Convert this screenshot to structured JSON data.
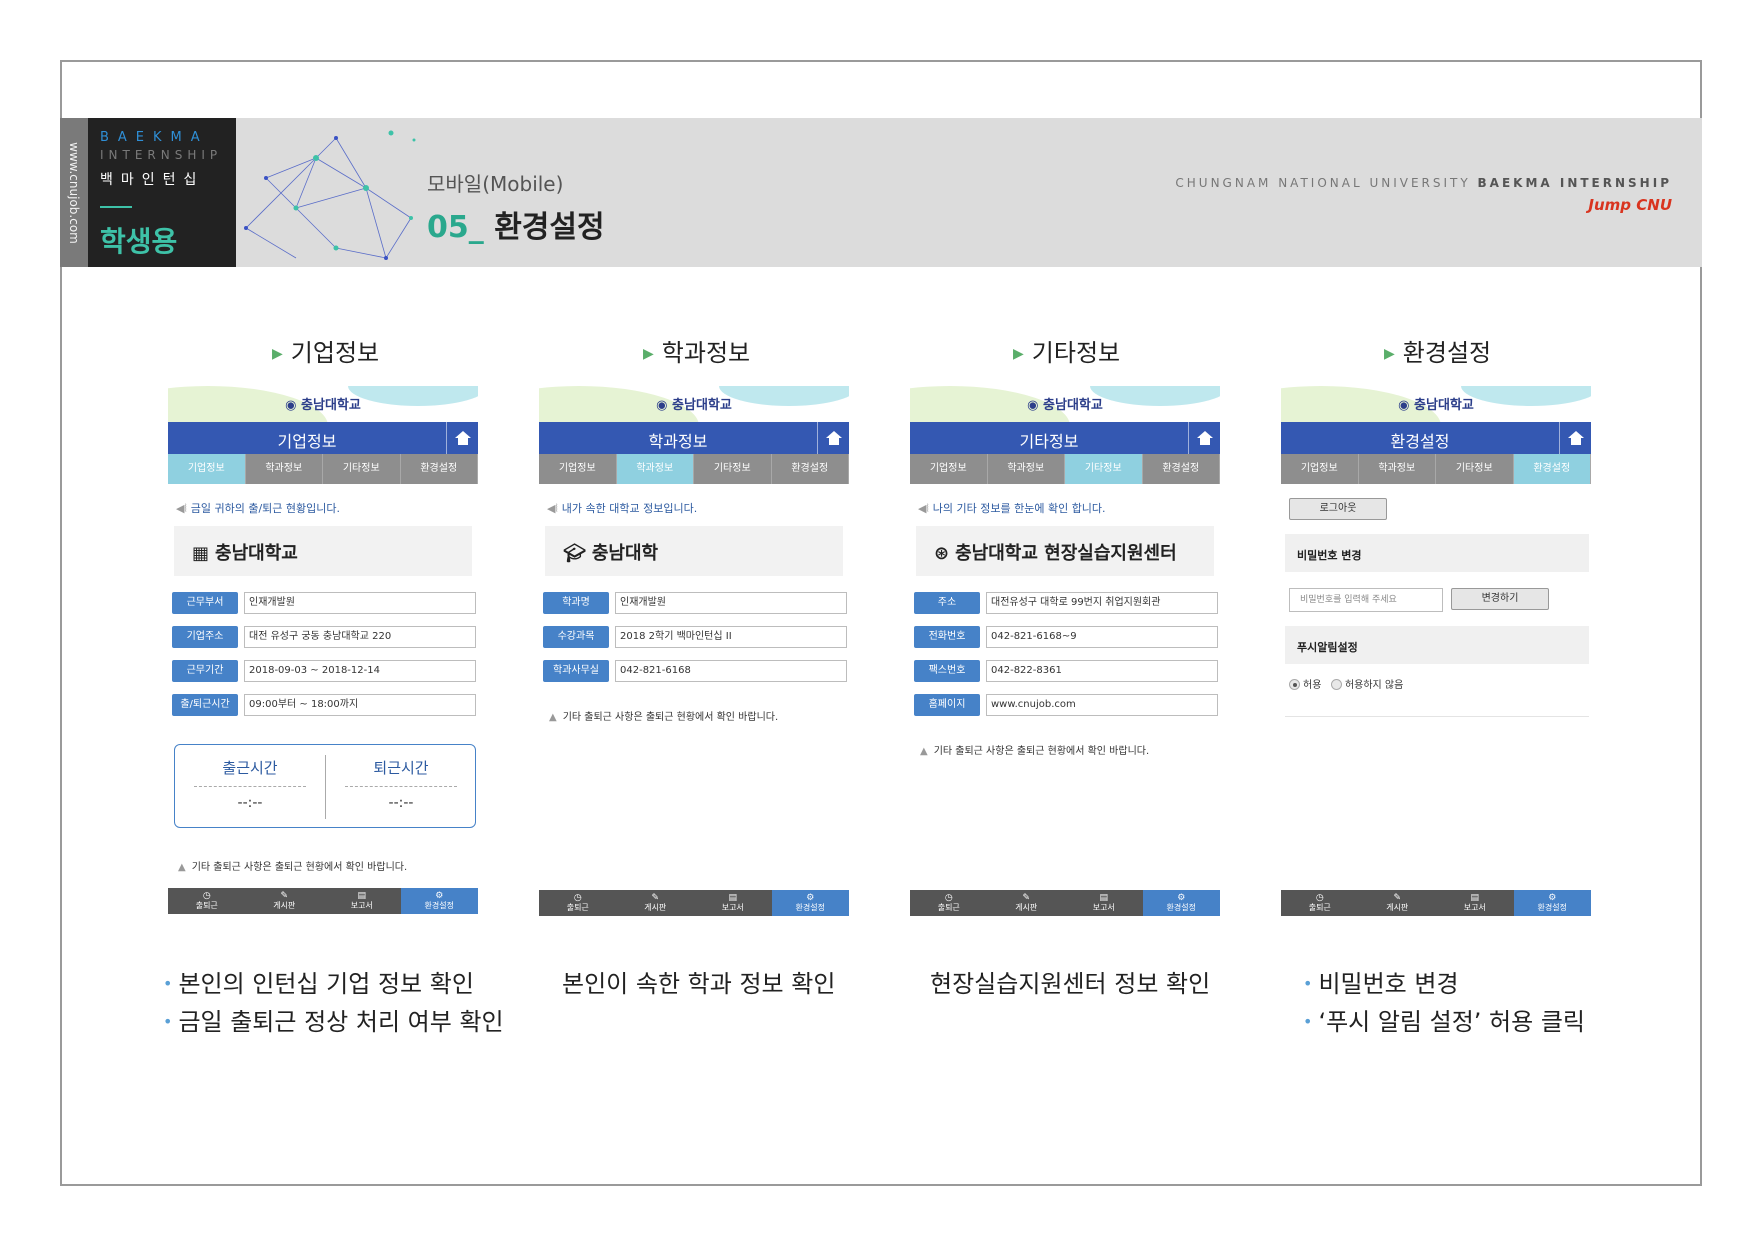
{
  "header": {
    "side_url": "www.cnujob.com",
    "logo_line1": "BAEKMA",
    "logo_line2": "INTERNSHIP",
    "logo_line3": "백마인턴십",
    "logo_line4": "학생용",
    "subtitle": "모바일(Mobile)",
    "title_num": "05_",
    "title_text": "환경설정",
    "right_text_light": "CHUNGNAM NATIONAL UNIVERSITY",
    "right_text_bold": "BAEKMA INTERNSHIP",
    "brand": "Jump CNU"
  },
  "common": {
    "univ_logo": "충남대학교",
    "tabs": [
      "기업정보",
      "학과정보",
      "기타정보",
      "환경설정"
    ],
    "nav": [
      "출퇴근",
      "게시판",
      "보고서",
      "환경설정"
    ],
    "footnote": "기타 출퇴근 사항은 출퇴근 현황에서 확인 바랍니다."
  },
  "screens": [
    {
      "heading": "기업정보",
      "title": "기업정보",
      "notice": "금일 귀하의 출/퇴근 현황입니다.",
      "card": "충남대학교",
      "fields": [
        {
          "label": "근무부서",
          "value": "인재개발원"
        },
        {
          "label": "기업주소",
          "value": "대전 유성구 궁동 충남대학교 220"
        },
        {
          "label": "근무기간",
          "value": "2018-09-03 ~ 2018-12-14"
        },
        {
          "label": "출/퇴근시간",
          "value": "09:00부터 ~ 18:00까지"
        }
      ],
      "checkin_label": "출근시간",
      "checkin_value": "--:--",
      "checkout_label": "퇴근시간",
      "checkout_value": "--:--"
    },
    {
      "heading": "학과정보",
      "title": "학과정보",
      "notice": "내가 속한 대학교 정보입니다.",
      "card": "충남대학",
      "fields": [
        {
          "label": "학과명",
          "value": "인재개발원"
        },
        {
          "label": "수강과목",
          "value": "2018 2학기 백마인턴십 II"
        },
        {
          "label": "학과사무실",
          "value": "042-821-6168"
        }
      ]
    },
    {
      "heading": "기타정보",
      "title": "기타정보",
      "notice": "나의 기타 정보를 한눈에 확인 합니다.",
      "card": "충남대학교 현장실습지원센터",
      "fields": [
        {
          "label": "주소",
          "value": "대전유성구 대학로 99번지 취업지원회관"
        },
        {
          "label": "전화번호",
          "value": "042-821-6168~9"
        },
        {
          "label": "팩스번호",
          "value": "042-822-8361"
        },
        {
          "label": "홈페이지",
          "value": "www.cnujob.com"
        }
      ]
    },
    {
      "heading": "환경설정",
      "title": "환경설정",
      "logout_label": "로그아웃",
      "pw_section": "비밀번호 변경",
      "pw_placeholder": "비밀번호를 입력해 주세요",
      "pw_button": "변경하기",
      "push_section": "푸시알림설정",
      "allow_label": "허용",
      "deny_label": "허용하지 않음"
    }
  ],
  "captions": {
    "c1_line1": "본인의 인턴십 기업 정보 확인",
    "c1_line2": "금일 출퇴근 정상 처리 여부 확인",
    "c2": "본인이 속한 학과 정보 확인",
    "c3": "현장실습지원센터 정보 확인",
    "c4_line1": "비밀번호 변경",
    "c4_line2": "‘푸시 알림 설정’ 허용 클릭"
  },
  "colors": {
    "header_blue": "#3458b2",
    "tab_active": "#8fd0e0",
    "label_blue": "#4682c8",
    "accent_teal": "#2aa88d",
    "brand_red": "#d9341f"
  }
}
